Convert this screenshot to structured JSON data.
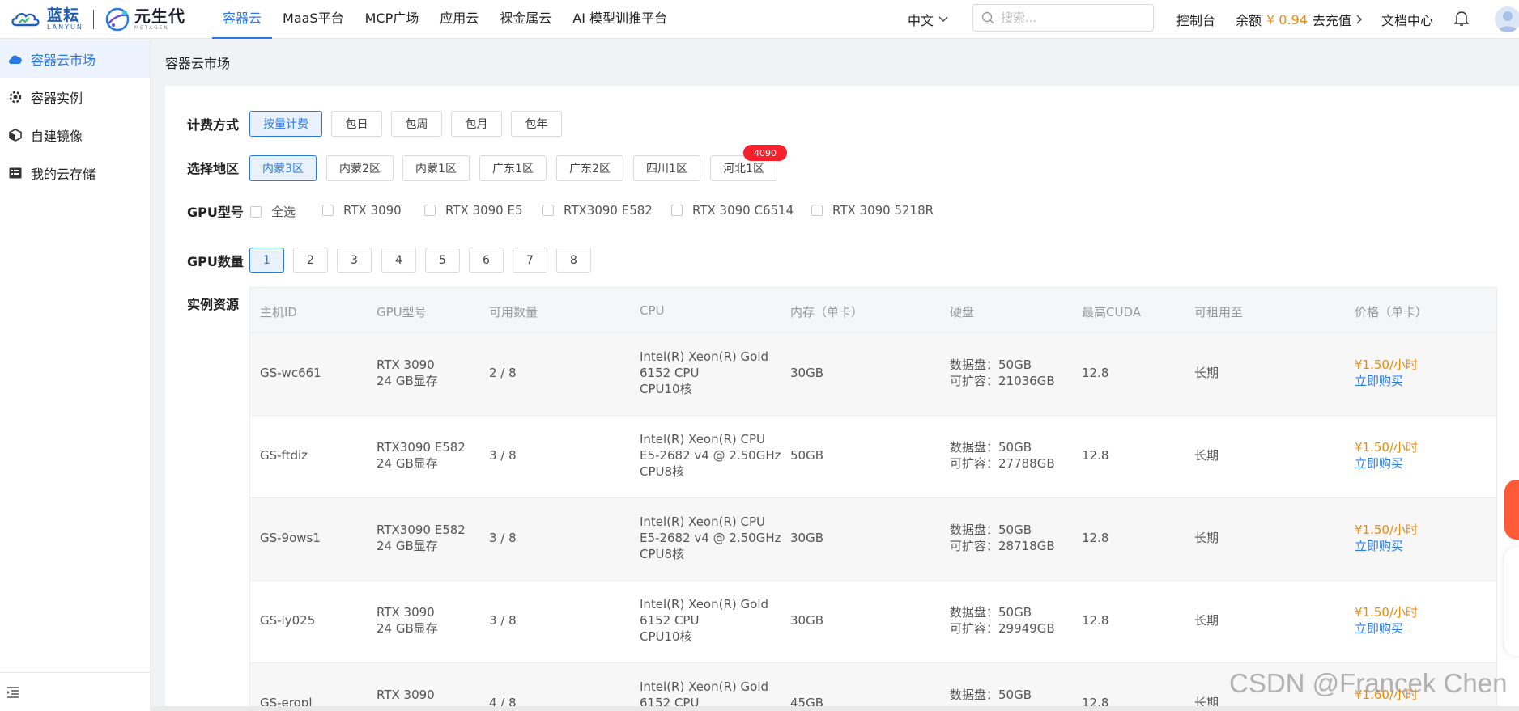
{
  "brand": {
    "lanyun_cn": "蓝耘",
    "lanyun_en": "LANYUN",
    "ysd_cn": "元生代",
    "ysd_en": "METAGEN"
  },
  "nav": [
    "容器云",
    "MaaS平台",
    "MCP广场",
    "应用云",
    "裸金属云",
    "AI 模型训推平台"
  ],
  "header": {
    "lang": "中文",
    "search_placeholder": "搜索...",
    "console": "控制台",
    "balance_label": "余额",
    "balance_amount": "¥ 0.94",
    "recharge": "去充值",
    "docs": "文档中心"
  },
  "sidebar": {
    "items": [
      "容器云市场",
      "容器实例",
      "自建镜像",
      "我的云存储"
    ]
  },
  "breadcrumb": "容器云市场",
  "filters": {
    "billing_label": "计费方式",
    "billing": [
      "按量计费",
      "包日",
      "包周",
      "包月",
      "包年"
    ],
    "region_label": "选择地区",
    "regions": [
      "内蒙3区",
      "内蒙2区",
      "内蒙1区",
      "广东1区",
      "广东2区",
      "四川1区",
      "河北1区"
    ],
    "region_badge": "4090",
    "gpu_type_label": "GPU型号",
    "gpu_types": [
      "全选",
      "RTX 3090",
      "RTX 3090 E5",
      "RTX3090 E582",
      "RTX 3090 C6514",
      "RTX 3090 5218R"
    ],
    "gpu_count_label": "GPU数量",
    "gpu_counts": [
      "1",
      "2",
      "3",
      "4",
      "5",
      "6",
      "7",
      "8"
    ],
    "resources_label": "实例资源"
  },
  "table": {
    "headers": [
      "主机ID",
      "GPU型号",
      "可用数量",
      "CPU",
      "内存（单卡）",
      "硬盘",
      "最高CUDA",
      "可租用至",
      "价格（单卡）"
    ],
    "rows": [
      {
        "id": "GS-wc661",
        "gpu1": "RTX 3090",
        "gpu2": "24 GB显存",
        "avail": "2 / 8",
        "cpu1": "Intel(R) Xeon(R) Gold",
        "cpu2": "6152 CPU",
        "cpu3": "CPU10核",
        "mem": "30GB",
        "disk1": "数据盘：50GB",
        "disk2": "可扩容：21036GB",
        "cuda": "12.8",
        "until": "长期",
        "price": "¥1.50/小时",
        "buy": "立即购买"
      },
      {
        "id": "GS-ftdiz",
        "gpu1": "RTX3090 E582",
        "gpu2": "24 GB显存",
        "avail": "3 / 8",
        "cpu1": "Intel(R) Xeon(R) CPU",
        "cpu2": "E5-2682 v4 @ 2.50GHz",
        "cpu3": "CPU8核",
        "mem": "50GB",
        "disk1": "数据盘：50GB",
        "disk2": "可扩容：27788GB",
        "cuda": "12.8",
        "until": "长期",
        "price": "¥1.50/小时",
        "buy": "立即购买"
      },
      {
        "id": "GS-9ows1",
        "gpu1": "RTX3090 E582",
        "gpu2": "24 GB显存",
        "avail": "3 / 8",
        "cpu1": "Intel(R) Xeon(R) CPU",
        "cpu2": "E5-2682 v4 @ 2.50GHz",
        "cpu3": "CPU8核",
        "mem": "30GB",
        "disk1": "数据盘：50GB",
        "disk2": "可扩容：28718GB",
        "cuda": "12.8",
        "until": "长期",
        "price": "¥1.50/小时",
        "buy": "立即购买"
      },
      {
        "id": "GS-ly025",
        "gpu1": "RTX 3090",
        "gpu2": "24 GB显存",
        "avail": "3 / 8",
        "cpu1": "Intel(R) Xeon(R) Gold",
        "cpu2": "6152 CPU",
        "cpu3": "CPU10核",
        "mem": "30GB",
        "disk1": "数据盘：50GB",
        "disk2": "可扩容：29949GB",
        "cuda": "12.8",
        "until": "长期",
        "price": "¥1.50/小时",
        "buy": "立即购买"
      },
      {
        "id": "GS-eropl",
        "gpu1": "RTX 3090",
        "gpu2": "",
        "avail": "4 / 8",
        "cpu1": "Intel(R) Xeon(R) Gold",
        "cpu2": "6152 CPU",
        "cpu3": "",
        "mem": "45GB",
        "disk1": "数据盘：50GB",
        "disk2": "",
        "cuda": "12.8",
        "until": "长期",
        "price": "¥1.60/小时",
        "buy": ""
      }
    ]
  },
  "watermark": "CSDN @Francek Chen",
  "colors": {
    "accent": "#2a78e4",
    "price": "#f08a00",
    "badge": "#f5222d"
  }
}
